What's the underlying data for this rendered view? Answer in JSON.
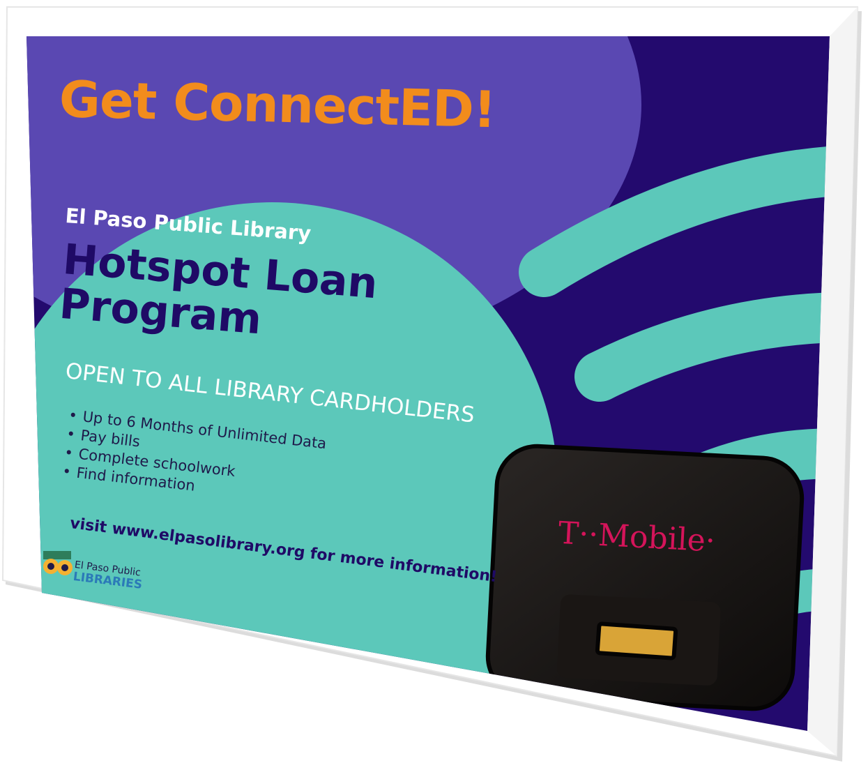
{
  "poster": {
    "headline": "Get ConnectED!",
    "library_name": "El Paso Public Library",
    "program_title_line1": "Hotspot Loan",
    "program_title_line2": "Program",
    "open_to": "OPEN TO ALL LIBRARY CARDHOLDERS",
    "bullets": [
      "Up to 6 Months of Unlimited Data",
      "Pay bills",
      "Complete schoolwork",
      "Find information"
    ],
    "visit": "visit www.elpasolibrary.org for more information!",
    "logo": {
      "line1": "El Paso Public",
      "line2": "LIBRARIES",
      "icon": "owl-logo-icon"
    },
    "device": {
      "brand_logo": "T··Mobile·",
      "icon": "hotspot-device"
    },
    "colors": {
      "background_dark": "#230a6e",
      "background_purple": "#5a48b2",
      "teal": "#5cc8ba",
      "headline_orange": "#f28c1c",
      "title_navy": "#1f0a66",
      "tmobile_magenta": "#d4145a"
    }
  }
}
